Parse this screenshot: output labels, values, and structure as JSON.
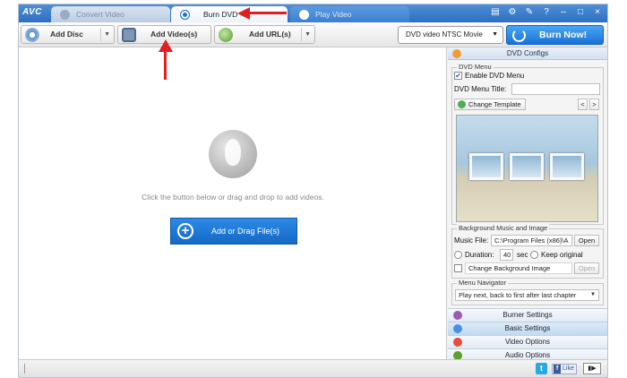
{
  "app": {
    "logo": "AVC"
  },
  "tabs": [
    {
      "label": "Convert Video"
    },
    {
      "label": "Burn DVD"
    },
    {
      "label": "Play Video"
    }
  ],
  "window_controls": {
    "help": "?",
    "minimize": "–",
    "maximize": "□",
    "close": "×"
  },
  "toolbar": {
    "add_disc": "Add Disc",
    "add_videos": "Add Video(s)",
    "add_urls": "Add URL(s)",
    "format_selected": "DVD video NTSC Movie",
    "burn_now": "Burn Now!"
  },
  "dropzone": {
    "hint": "Click the button below or drag and drop to add videos.",
    "add_button": "Add or Drag File(s)"
  },
  "panel": {
    "header": "DVD Configs",
    "dvd_menu": {
      "group_title": "DVD Menu",
      "enable_label": "Enable DVD Menu",
      "enable_checked": true,
      "title_label": "DVD Menu Title:",
      "title_value": "",
      "change_template": "Change Template",
      "prev": "<",
      "next": ">"
    },
    "background": {
      "group_title": "Background Music and Image",
      "music_label": "Music File:",
      "music_value": "C:\\Program Files (x86)\\A",
      "open_label": "Open",
      "duration_label": "Duration:",
      "duration_value": "40",
      "duration_unit": "sec",
      "keep_original": "Keep original",
      "change_bg_image": "Change Background Image",
      "open_disabled_label": "Open"
    },
    "navigator": {
      "group_title": "Menu Navigator",
      "selected": "Play next, back to first after last chapter"
    },
    "sections": [
      {
        "label": "Burner Settings",
        "color": "#9b59b6"
      },
      {
        "label": "Basic Settings",
        "color": "#4a90e2"
      },
      {
        "label": "Video Options",
        "color": "#e74c3c"
      },
      {
        "label": "Audio Options",
        "color": "#5aa02c"
      }
    ]
  },
  "statusbar": {
    "twitter": "t",
    "like": "Like",
    "layout_icon": "▮▶"
  },
  "colors": {
    "accent": "#1a72d6",
    "annotation_arrow": "#e02020"
  }
}
